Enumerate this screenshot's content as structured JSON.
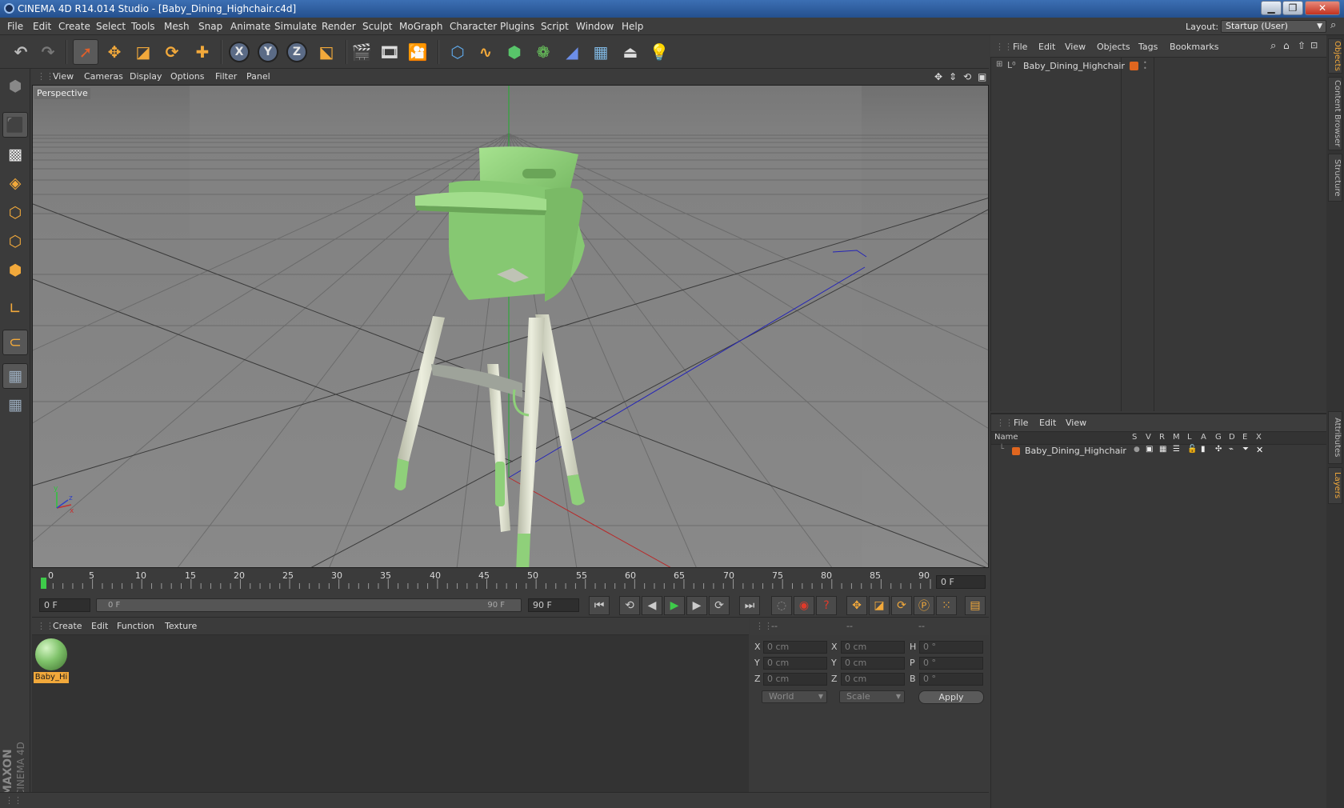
{
  "window": {
    "title": "CINEMA 4D R14.014 Studio - [Baby_Dining_Highchair.c4d]",
    "minimize": "▁",
    "restore": "❐",
    "close": "✕"
  },
  "menubar": {
    "items": [
      "File",
      "Edit",
      "Create",
      "Select",
      "Tools",
      "Mesh",
      "Snap",
      "Animate",
      "Simulate",
      "Render",
      "Sculpt",
      "MoGraph",
      "Character",
      "Plugins",
      "Script",
      "Window",
      "Help"
    ],
    "layout_label": "Layout:",
    "layout_value": "Startup (User)"
  },
  "toolbar": {
    "axis_x": "X",
    "axis_y": "Y",
    "axis_z": "Z"
  },
  "viewport": {
    "menu": [
      "View",
      "Cameras",
      "Display",
      "Options",
      "Filter",
      "Panel"
    ],
    "label": "Perspective",
    "axis_y": "y",
    "axis_z": "z",
    "axis_x": "x"
  },
  "timeline": {
    "ticks": [
      "0",
      "5",
      "10",
      "15",
      "20",
      "25",
      "30",
      "35",
      "40",
      "45",
      "50",
      "55",
      "60",
      "65",
      "70",
      "75",
      "80",
      "85",
      "90"
    ],
    "current_frame_field": "0 F",
    "end_frame_field": "90 F",
    "range_start": "0 F",
    "range_end": "90 F",
    "range_max": "90 F"
  },
  "materials": {
    "menu": [
      "Create",
      "Edit",
      "Function",
      "Texture"
    ],
    "items": [
      {
        "label": "Baby_Hi",
        "color": "#7fc26a"
      }
    ]
  },
  "coordinates": {
    "header": [
      "--",
      "--",
      "--"
    ],
    "rows": [
      {
        "pos_label": "X",
        "pos": "0 cm",
        "size_label": "X",
        "size": "0 cm",
        "rot_label": "H",
        "rot": "0 °"
      },
      {
        "pos_label": "Y",
        "pos": "0 cm",
        "size_label": "Y",
        "size": "0 cm",
        "rot_label": "P",
        "rot": "0 °"
      },
      {
        "pos_label": "Z",
        "pos": "0 cm",
        "size_label": "Z",
        "size": "0 cm",
        "rot_label": "B",
        "rot": "0 °"
      }
    ],
    "mode": "World",
    "size_mode": "Scale",
    "apply": "Apply"
  },
  "objects": {
    "menu": [
      "File",
      "Edit",
      "View",
      "Objects",
      "Tags",
      "Bookmarks"
    ],
    "tree": [
      {
        "name": "Baby_Dining_Highchair",
        "tag_color": "#e0661f"
      }
    ]
  },
  "layers": {
    "menu": [
      "File",
      "Edit",
      "View"
    ],
    "columns": [
      "Name",
      "S",
      "V",
      "R",
      "M",
      "L",
      "A",
      "G",
      "D",
      "E",
      "X"
    ],
    "rows": [
      {
        "name": "Baby_Dining_Highchair",
        "color": "#e0661f"
      }
    ]
  },
  "right_tabs": [
    "Objects",
    "Content Browser",
    "Structure",
    "Attributes",
    "Layers"
  ],
  "branding": {
    "maxon": "MAXON",
    "product": "CINEMA 4D"
  },
  "colors": {
    "accent": "#f2a93b",
    "chair_green": "#8fd07a",
    "chair_leg": "#d9dcc8"
  }
}
